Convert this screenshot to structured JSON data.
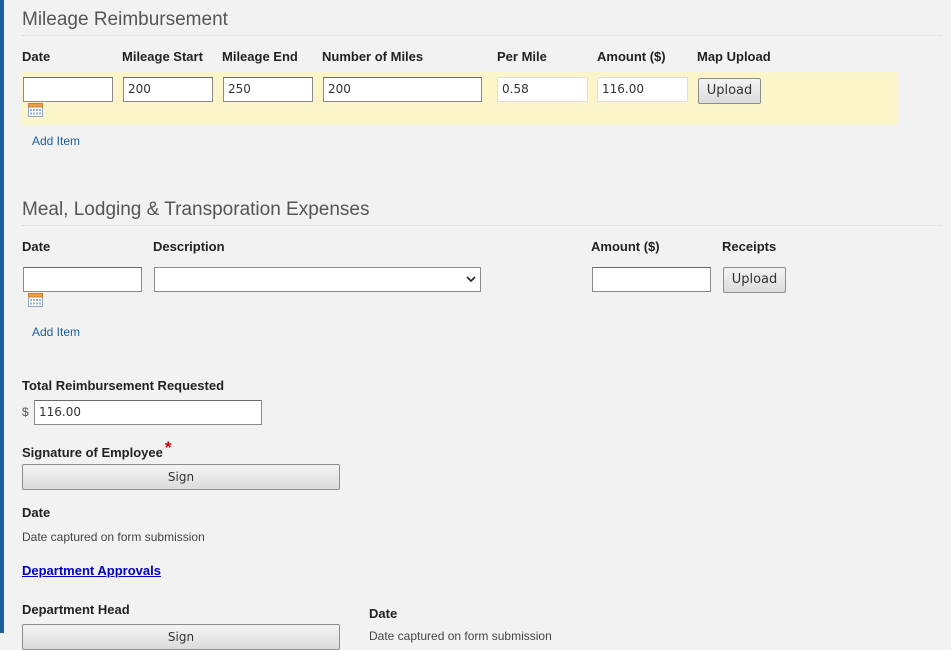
{
  "colors": {
    "row_highlight": "#fcf5c9",
    "link": "#1a5fa0",
    "department_link": "#0000cc",
    "required": "#cc0000"
  },
  "mileage": {
    "title": "Mileage Reimbursement",
    "headers": [
      "Date",
      "Mileage Start",
      "Mileage End",
      "Number of Miles",
      "Per Mile",
      "Amount ($)",
      "Map Upload"
    ],
    "row": {
      "date": "",
      "mileage_start": "200",
      "mileage_end": "250",
      "number_of_miles": "200",
      "per_mile": "0.58",
      "amount": "116.00"
    },
    "upload_label": "Upload",
    "add_item": "Add Item"
  },
  "meals": {
    "title": "Meal, Lodging & Transporation Expenses",
    "headers": [
      "Date",
      "Description",
      "Amount ($)",
      "Receipts"
    ],
    "row": {
      "date": "",
      "description": "",
      "amount": ""
    },
    "upload_label": "Upload",
    "add_item": "Add Item"
  },
  "total": {
    "label": "Total Reimbursement Requested",
    "currency": "$",
    "value": "116.00"
  },
  "signature": {
    "label": "Signature of Employee",
    "required_mark": "*",
    "sign_label": "Sign"
  },
  "date_block": {
    "label": "Date",
    "note": "Date captured on form submission"
  },
  "department": {
    "link": "Department Approvals",
    "head_label": "Department Head",
    "sign_label": "Sign",
    "date_label": "Date",
    "date_note": "Date captured on form submission"
  },
  "icons": [
    "calendar-icon",
    "chevron-down-icon"
  ]
}
